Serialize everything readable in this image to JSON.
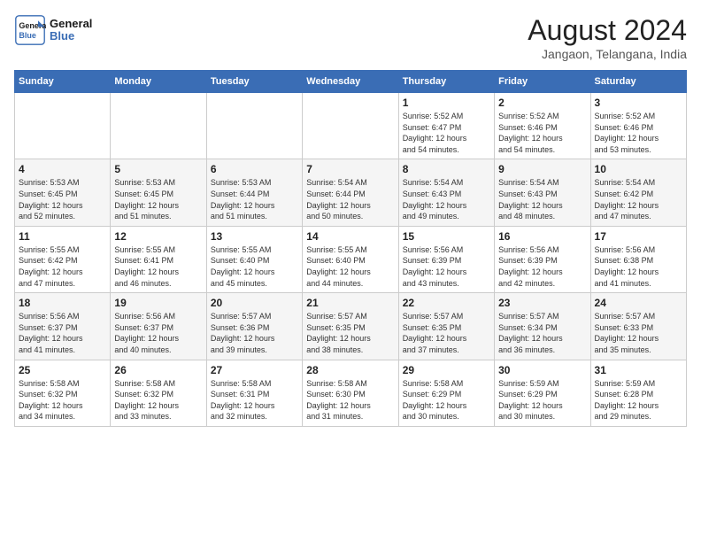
{
  "header": {
    "logo_line1": "General",
    "logo_line2": "Blue",
    "month_year": "August 2024",
    "location": "Jangaon, Telangana, India"
  },
  "weekdays": [
    "Sunday",
    "Monday",
    "Tuesday",
    "Wednesday",
    "Thursday",
    "Friday",
    "Saturday"
  ],
  "weeks": [
    [
      {
        "day": "",
        "info": ""
      },
      {
        "day": "",
        "info": ""
      },
      {
        "day": "",
        "info": ""
      },
      {
        "day": "",
        "info": ""
      },
      {
        "day": "1",
        "info": "Sunrise: 5:52 AM\nSunset: 6:47 PM\nDaylight: 12 hours\nand 54 minutes."
      },
      {
        "day": "2",
        "info": "Sunrise: 5:52 AM\nSunset: 6:46 PM\nDaylight: 12 hours\nand 54 minutes."
      },
      {
        "day": "3",
        "info": "Sunrise: 5:52 AM\nSunset: 6:46 PM\nDaylight: 12 hours\nand 53 minutes."
      }
    ],
    [
      {
        "day": "4",
        "info": "Sunrise: 5:53 AM\nSunset: 6:45 PM\nDaylight: 12 hours\nand 52 minutes."
      },
      {
        "day": "5",
        "info": "Sunrise: 5:53 AM\nSunset: 6:45 PM\nDaylight: 12 hours\nand 51 minutes."
      },
      {
        "day": "6",
        "info": "Sunrise: 5:53 AM\nSunset: 6:44 PM\nDaylight: 12 hours\nand 51 minutes."
      },
      {
        "day": "7",
        "info": "Sunrise: 5:54 AM\nSunset: 6:44 PM\nDaylight: 12 hours\nand 50 minutes."
      },
      {
        "day": "8",
        "info": "Sunrise: 5:54 AM\nSunset: 6:43 PM\nDaylight: 12 hours\nand 49 minutes."
      },
      {
        "day": "9",
        "info": "Sunrise: 5:54 AM\nSunset: 6:43 PM\nDaylight: 12 hours\nand 48 minutes."
      },
      {
        "day": "10",
        "info": "Sunrise: 5:54 AM\nSunset: 6:42 PM\nDaylight: 12 hours\nand 47 minutes."
      }
    ],
    [
      {
        "day": "11",
        "info": "Sunrise: 5:55 AM\nSunset: 6:42 PM\nDaylight: 12 hours\nand 47 minutes."
      },
      {
        "day": "12",
        "info": "Sunrise: 5:55 AM\nSunset: 6:41 PM\nDaylight: 12 hours\nand 46 minutes."
      },
      {
        "day": "13",
        "info": "Sunrise: 5:55 AM\nSunset: 6:40 PM\nDaylight: 12 hours\nand 45 minutes."
      },
      {
        "day": "14",
        "info": "Sunrise: 5:55 AM\nSunset: 6:40 PM\nDaylight: 12 hours\nand 44 minutes."
      },
      {
        "day": "15",
        "info": "Sunrise: 5:56 AM\nSunset: 6:39 PM\nDaylight: 12 hours\nand 43 minutes."
      },
      {
        "day": "16",
        "info": "Sunrise: 5:56 AM\nSunset: 6:39 PM\nDaylight: 12 hours\nand 42 minutes."
      },
      {
        "day": "17",
        "info": "Sunrise: 5:56 AM\nSunset: 6:38 PM\nDaylight: 12 hours\nand 41 minutes."
      }
    ],
    [
      {
        "day": "18",
        "info": "Sunrise: 5:56 AM\nSunset: 6:37 PM\nDaylight: 12 hours\nand 41 minutes."
      },
      {
        "day": "19",
        "info": "Sunrise: 5:56 AM\nSunset: 6:37 PM\nDaylight: 12 hours\nand 40 minutes."
      },
      {
        "day": "20",
        "info": "Sunrise: 5:57 AM\nSunset: 6:36 PM\nDaylight: 12 hours\nand 39 minutes."
      },
      {
        "day": "21",
        "info": "Sunrise: 5:57 AM\nSunset: 6:35 PM\nDaylight: 12 hours\nand 38 minutes."
      },
      {
        "day": "22",
        "info": "Sunrise: 5:57 AM\nSunset: 6:35 PM\nDaylight: 12 hours\nand 37 minutes."
      },
      {
        "day": "23",
        "info": "Sunrise: 5:57 AM\nSunset: 6:34 PM\nDaylight: 12 hours\nand 36 minutes."
      },
      {
        "day": "24",
        "info": "Sunrise: 5:57 AM\nSunset: 6:33 PM\nDaylight: 12 hours\nand 35 minutes."
      }
    ],
    [
      {
        "day": "25",
        "info": "Sunrise: 5:58 AM\nSunset: 6:32 PM\nDaylight: 12 hours\nand 34 minutes."
      },
      {
        "day": "26",
        "info": "Sunrise: 5:58 AM\nSunset: 6:32 PM\nDaylight: 12 hours\nand 33 minutes."
      },
      {
        "day": "27",
        "info": "Sunrise: 5:58 AM\nSunset: 6:31 PM\nDaylight: 12 hours\nand 32 minutes."
      },
      {
        "day": "28",
        "info": "Sunrise: 5:58 AM\nSunset: 6:30 PM\nDaylight: 12 hours\nand 31 minutes."
      },
      {
        "day": "29",
        "info": "Sunrise: 5:58 AM\nSunset: 6:29 PM\nDaylight: 12 hours\nand 30 minutes."
      },
      {
        "day": "30",
        "info": "Sunrise: 5:59 AM\nSunset: 6:29 PM\nDaylight: 12 hours\nand 30 minutes."
      },
      {
        "day": "31",
        "info": "Sunrise: 5:59 AM\nSunset: 6:28 PM\nDaylight: 12 hours\nand 29 minutes."
      }
    ]
  ]
}
